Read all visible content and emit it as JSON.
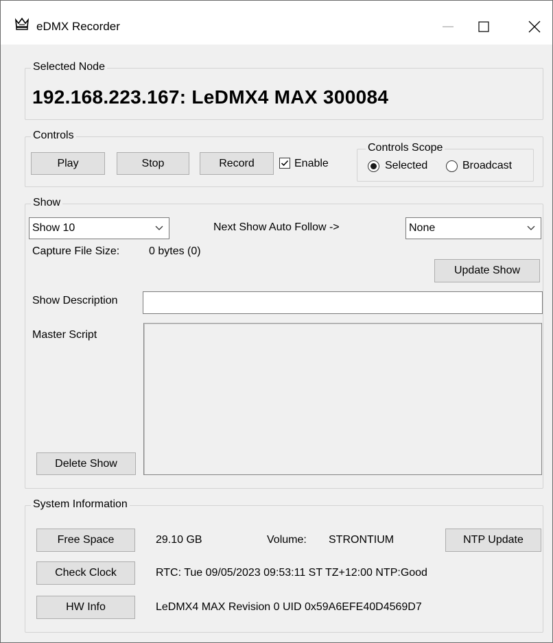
{
  "window": {
    "title": "eDMX Recorder",
    "icon": "crown-icon",
    "minimize_glyph": "—",
    "maximize_glyph": "☐",
    "close_glyph": "✕"
  },
  "selected_node": {
    "legend": "Selected Node",
    "value": "192.168.223.167: LeDMX4 MAX 300084"
  },
  "controls": {
    "legend": "Controls",
    "play_label": "Play",
    "stop_label": "Stop",
    "record_label": "Record",
    "enable_label": "Enable",
    "enable_checked": true,
    "scope": {
      "legend": "Controls Scope",
      "selected_label": "Selected",
      "broadcast_label": "Broadcast",
      "current": "Selected"
    }
  },
  "show": {
    "legend": "Show",
    "show_select_value": "Show 10",
    "auto_follow_label": "Next Show Auto Follow ->",
    "auto_follow_value": "None",
    "capture_size_label": "Capture File Size:",
    "capture_size_value": "0 bytes  (0)",
    "update_show_label": "Update Show",
    "description_label": "Show Description",
    "description_value": "",
    "master_script_label": "Master Script",
    "master_script_value": "",
    "delete_show_label": "Delete Show"
  },
  "system_info": {
    "legend": "System Information",
    "free_space_label": "Free Space",
    "free_space_value": "29.10 GB",
    "volume_label": "Volume:",
    "volume_value": "STRONTIUM",
    "ntp_update_label": "NTP Update",
    "check_clock_label": "Check Clock",
    "clock_value": "RTC: Tue 09/05/2023 09:53:11 ST  TZ+12:00 NTP:Good",
    "hw_info_label": "HW Info",
    "hw_info_value": "LeDMX4 MAX Revision 0 UID 0x59A6EFE40D4569D7"
  },
  "colors": {
    "window_bg": "#f0f0f0",
    "button_bg": "#e1e1e1",
    "button_border": "#adadad",
    "group_border": "#d3d3d3"
  }
}
